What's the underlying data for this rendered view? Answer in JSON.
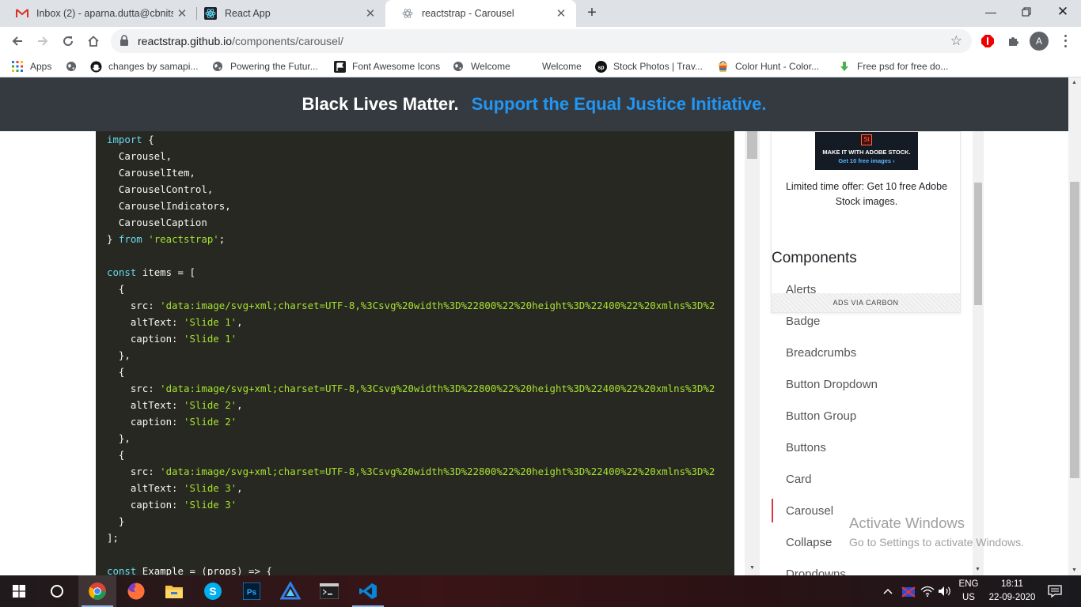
{
  "tabs": [
    {
      "title": "Inbox (2) - aparna.dutta@cbnits.c",
      "icon": "gmail-icon"
    },
    {
      "title": "React App",
      "icon": "react-icon"
    },
    {
      "title": "reactstrap - Carousel",
      "icon": "reactstrap-icon"
    }
  ],
  "address_bar": {
    "domain": "reactstrap.github.io",
    "path": "/components/carousel/"
  },
  "profile_initial": "A",
  "bookmarks": [
    {
      "label": "Apps"
    },
    {
      "label": ""
    },
    {
      "label": "changes by samapi..."
    },
    {
      "label": "Powering the Futur..."
    },
    {
      "label": "Font Awesome Icons"
    },
    {
      "label": "Welcome"
    },
    {
      "label": "Welcome"
    },
    {
      "label": "Stock Photos | Trav..."
    },
    {
      "label": "Color Hunt - Color..."
    },
    {
      "label": "Free psd for free do..."
    }
  ],
  "banner": {
    "text1": "Black Lives Matter.",
    "text2": "Support the Equal Justice Initiative."
  },
  "code_lines": [
    [
      [
        "kw",
        "import"
      ],
      [
        "p",
        " {"
      ]
    ],
    [
      [
        "p",
        "  Carousel,"
      ]
    ],
    [
      [
        "p",
        "  CarouselItem,"
      ]
    ],
    [
      [
        "p",
        "  CarouselControl,"
      ]
    ],
    [
      [
        "p",
        "  CarouselIndicators,"
      ]
    ],
    [
      [
        "p",
        "  CarouselCaption"
      ]
    ],
    [
      [
        "p",
        "} "
      ],
      [
        "kw",
        "from"
      ],
      [
        "p",
        " "
      ],
      [
        "str",
        "'reactstrap'"
      ],
      [
        "p",
        ";"
      ]
    ],
    [
      [
        "p",
        ""
      ]
    ],
    [
      [
        "kw",
        "const"
      ],
      [
        "p",
        " items = ["
      ]
    ],
    [
      [
        "p",
        "  {"
      ]
    ],
    [
      [
        "p",
        "    src: "
      ],
      [
        "str",
        "'data:image/svg+xml;charset=UTF-8,%3Csvg%20width%3D%22800%22%20height%3D%22400%22%20xmlns%3D%2"
      ]
    ],
    [
      [
        "p",
        "    altText: "
      ],
      [
        "str",
        "'Slide 1'"
      ],
      [
        "p",
        ","
      ]
    ],
    [
      [
        "p",
        "    caption: "
      ],
      [
        "str",
        "'Slide 1'"
      ]
    ],
    [
      [
        "p",
        "  },"
      ]
    ],
    [
      [
        "p",
        "  {"
      ]
    ],
    [
      [
        "p",
        "    src: "
      ],
      [
        "str",
        "'data:image/svg+xml;charset=UTF-8,%3Csvg%20width%3D%22800%22%20height%3D%22400%22%20xmlns%3D%2"
      ]
    ],
    [
      [
        "p",
        "    altText: "
      ],
      [
        "str",
        "'Slide 2'"
      ],
      [
        "p",
        ","
      ]
    ],
    [
      [
        "p",
        "    caption: "
      ],
      [
        "str",
        "'Slide 2'"
      ]
    ],
    [
      [
        "p",
        "  },"
      ]
    ],
    [
      [
        "p",
        "  {"
      ]
    ],
    [
      [
        "p",
        "    src: "
      ],
      [
        "str",
        "'data:image/svg+xml;charset=UTF-8,%3Csvg%20width%3D%22800%22%20height%3D%22400%22%20xmlns%3D%2"
      ]
    ],
    [
      [
        "p",
        "    altText: "
      ],
      [
        "str",
        "'Slide 3'"
      ],
      [
        "p",
        ","
      ]
    ],
    [
      [
        "p",
        "    caption: "
      ],
      [
        "str",
        "'Slide 3'"
      ]
    ],
    [
      [
        "p",
        "  }"
      ]
    ],
    [
      [
        "p",
        "];"
      ]
    ],
    [
      [
        "p",
        ""
      ]
    ],
    [
      [
        "kw",
        "const"
      ],
      [
        "p",
        " Example = (props) => {"
      ]
    ]
  ],
  "ad": {
    "headline": "MAKE IT WITH ADOBE STOCK.",
    "subline": "Get 10 free images ›",
    "logo_text": "St",
    "text": "Limited time offer: Get 10 free Adobe Stock images.",
    "via": "ADS VIA CARBON"
  },
  "components_title": "Components",
  "nav_items": [
    "Alerts",
    "Badge",
    "Breadcrumbs",
    "Button Dropdown",
    "Button Group",
    "Buttons",
    "Card",
    "Carousel",
    "Collapse",
    "Dropdowns"
  ],
  "active_nav": "Carousel",
  "watermark": {
    "line1": "Activate Windows",
    "line2": "Go to Settings to activate Windows."
  },
  "tray": {
    "lang": "ENG",
    "region": "US",
    "time": "18:11",
    "date": "22-09-2020"
  },
  "colors": {
    "banner_bg": "#343a40",
    "banner_link": "#2196f3",
    "code_bg": "#272822",
    "keyword": "#66d9ef",
    "string": "#a6e22e",
    "nav_active_border": "#dc3545"
  }
}
